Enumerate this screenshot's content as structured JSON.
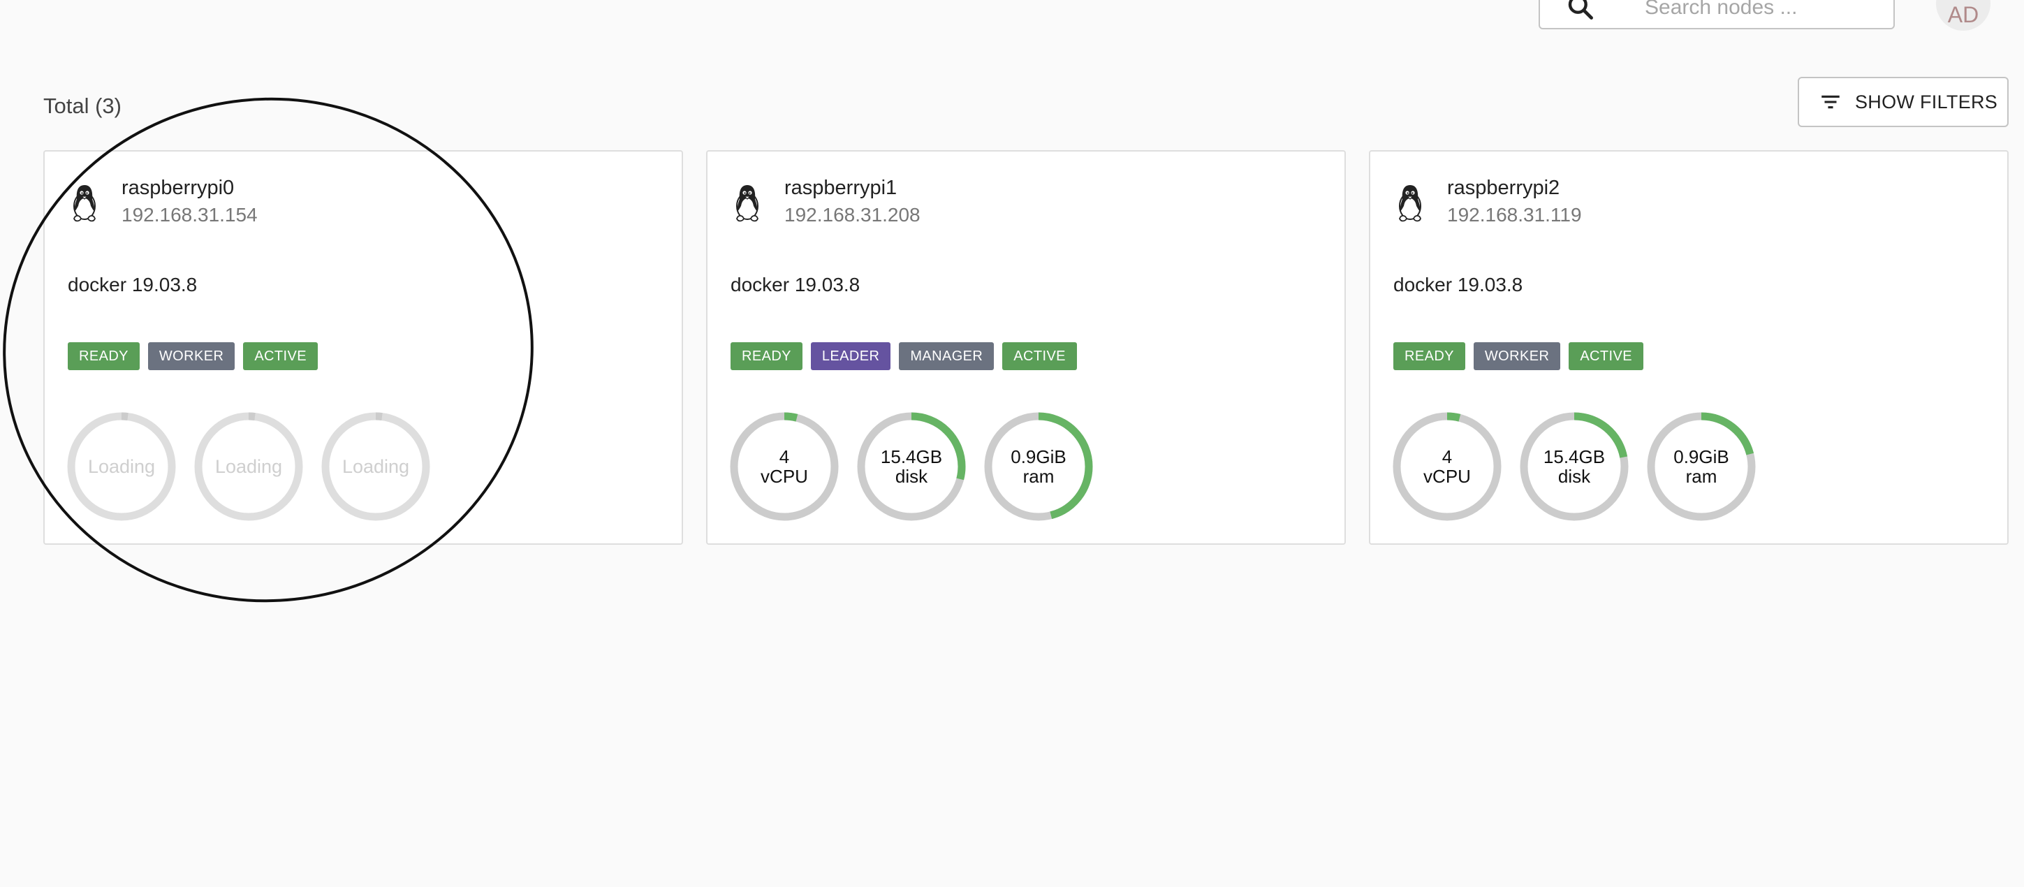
{
  "search": {
    "placeholder": "Search nodes ..."
  },
  "avatar": {
    "initials": "AD"
  },
  "total_label": "Total (3)",
  "filters_button": {
    "label": "SHOW FILTERS"
  },
  "colors": {
    "ready": "#5a9e57",
    "worker": "#6b7280",
    "active": "#5a9e57",
    "leader": "#6553a0",
    "manager": "#6b7280",
    "gauge_track": "#cccccc",
    "gauge_fill": "#66b464",
    "loading_track": "#dedede",
    "loading_fill": "#cccccc"
  },
  "nodes": [
    {
      "name": "raspberrypi0",
      "ip": "192.168.31.154",
      "engine": "docker 19.03.8",
      "os_icon": "linux-tux-icon",
      "chips": [
        {
          "label": "READY",
          "color": "#5a9e57"
        },
        {
          "label": "WORKER",
          "color": "#6b7280"
        },
        {
          "label": "ACTIVE",
          "color": "#5a9e57"
        }
      ],
      "gauges": [
        {
          "line1": "Loading",
          "line2": "",
          "fraction": 0.02,
          "loading": true
        },
        {
          "line1": "Loading",
          "line2": "",
          "fraction": 0.02,
          "loading": true
        },
        {
          "line1": "Loading",
          "line2": "",
          "fraction": 0.02,
          "loading": true
        }
      ]
    },
    {
      "name": "raspberrypi1",
      "ip": "192.168.31.208",
      "engine": "docker 19.03.8",
      "os_icon": "linux-tux-icon",
      "chips": [
        {
          "label": "READY",
          "color": "#5a9e57"
        },
        {
          "label": "LEADER",
          "color": "#6553a0"
        },
        {
          "label": "MANAGER",
          "color": "#6b7280"
        },
        {
          "label": "ACTIVE",
          "color": "#5a9e57"
        }
      ],
      "gauges": [
        {
          "line1": "4",
          "line2": "vCPU",
          "fraction": 0.04,
          "loading": false
        },
        {
          "line1": "15.4GB",
          "line2": "disk",
          "fraction": 0.29,
          "loading": false
        },
        {
          "line1": "0.9GiB",
          "line2": "ram",
          "fraction": 0.46,
          "loading": false
        }
      ]
    },
    {
      "name": "raspberrypi2",
      "ip": "192.168.31.119",
      "engine": "docker 19.03.8",
      "os_icon": "linux-tux-icon",
      "chips": [
        {
          "label": "READY",
          "color": "#5a9e57"
        },
        {
          "label": "WORKER",
          "color": "#6b7280"
        },
        {
          "label": "ACTIVE",
          "color": "#5a9e57"
        }
      ],
      "gauges": [
        {
          "line1": "4",
          "line2": "vCPU",
          "fraction": 0.04,
          "loading": false
        },
        {
          "line1": "15.4GB",
          "line2": "disk",
          "fraction": 0.22,
          "loading": false
        },
        {
          "line1": "0.9GiB",
          "line2": "ram",
          "fraction": 0.21,
          "loading": false
        }
      ]
    }
  ]
}
